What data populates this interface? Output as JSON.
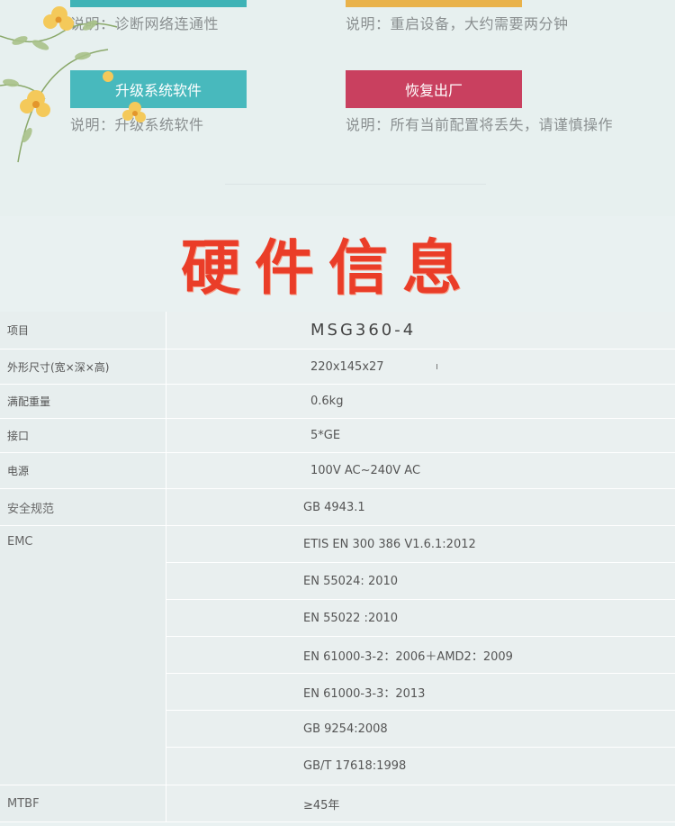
{
  "buttons": {
    "diagnose": {
      "desc": "说明：诊断网络连通性"
    },
    "reboot": {
      "desc": "说明：重启设备，大约需要两分钟"
    },
    "upgrade": {
      "label": "升级系统软件",
      "desc": "说明：升级系统软件"
    },
    "reset": {
      "label": "恢复出厂",
      "desc": "说明：所有当前配置将丢失，请谨慎操作"
    }
  },
  "colors": {
    "teal": "#48b9bd",
    "amber": "#e9b24a",
    "crimson": "#c9405f",
    "heading_red": "#ea3d28"
  },
  "heading": "硬件信息",
  "table": {
    "header": {
      "label": "项目",
      "value": "MSG360-4"
    },
    "rows": [
      {
        "label": "外形尺寸(宽×深×高)",
        "value": "220x145x27"
      },
      {
        "label": "满配重量",
        "value": "0.6kg"
      },
      {
        "label": "接口",
        "value": "5*GE"
      },
      {
        "label": "电源",
        "value": "100V AC~240V AC"
      }
    ],
    "safety": {
      "label": "安全规范",
      "value": "GB 4943.1"
    },
    "emc": {
      "label": "EMC",
      "values": [
        "ETIS EN 300 386 V1.6.1:2012",
        "EN 55024: 2010",
        "EN 55022 :2010",
        "EN 61000-3-2：2006＋AMD2：2009",
        "EN 61000-3-3：2013",
        "GB 9254:2008",
        "GB/T 17618:1998"
      ]
    },
    "mtbf": {
      "label": "MTBF",
      "value": "≥45年"
    }
  }
}
